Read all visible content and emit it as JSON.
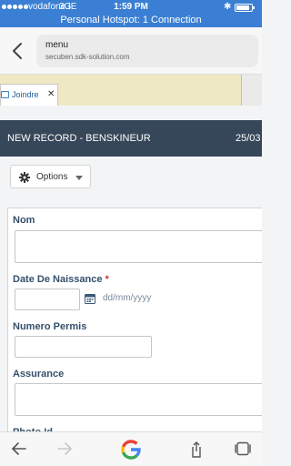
{
  "status_bar": {
    "carrier": "vodafone IE",
    "network": "3G",
    "time": "1:59 PM",
    "hotspot": "Personal Hotspot: 1 Connection",
    "battery_level": 0.9,
    "color": "#3a7fd3"
  },
  "browser": {
    "page_title": "menu",
    "host": "secuben.sdk-solution.com",
    "icons": {
      "back": "chevron-left-icon",
      "nav_back": "arrow-left-icon",
      "nav_forward": "arrow-right-icon",
      "google": "google-logo",
      "share": "share-icon",
      "tabs": "tabs-icon"
    }
  },
  "tab": {
    "label": "Joindre",
    "close": "✕"
  },
  "header": {
    "title": "NEW RECORD - BENSKINEUR",
    "date": "25/03"
  },
  "toolbar": {
    "options_label": "Options"
  },
  "form": {
    "nom_label": "Nom",
    "dob_label": "Date De Naissance",
    "required_mark": "*",
    "dob_placeholder": "dd/mm/yyyy",
    "permis_label": "Numero Permis",
    "assurance_label": "Assurance",
    "photo_label": "Photo Id"
  },
  "colors": {
    "header_bg": "#37475a",
    "label": "#35506b",
    "tab_strip": "#efe8c4",
    "required": "#d32f2f"
  }
}
